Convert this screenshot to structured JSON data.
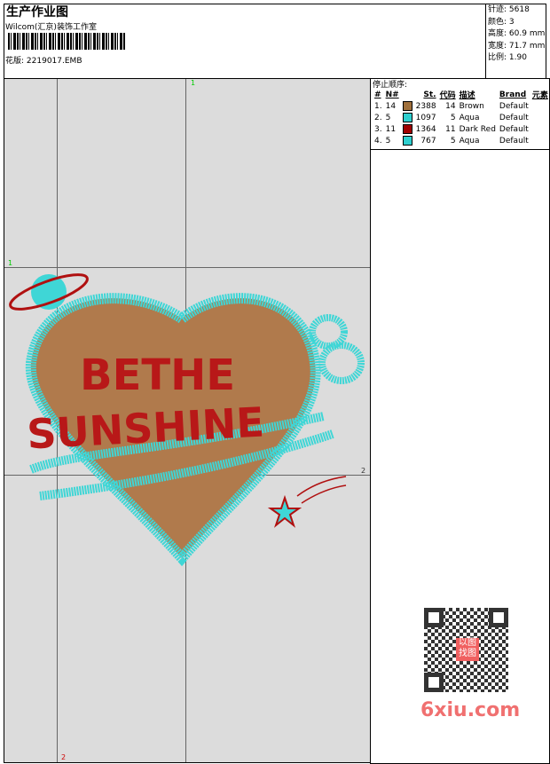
{
  "header": {
    "title": "生产作业图",
    "company": "Wilcom(汇京)装饰工作室",
    "design_label": "花版:",
    "design_file": "2219017.EMB"
  },
  "stats": [
    {
      "label": "针迹:",
      "value": "5618"
    },
    {
      "label": "颜色:",
      "value": "3"
    },
    {
      "label": "高度:",
      "value": "60.9 mm"
    },
    {
      "label": "宽度:",
      "value": "71.7 mm"
    },
    {
      "label": "比例:",
      "value": "1.90"
    }
  ],
  "stop_sequence": {
    "title": "停止顺序:",
    "columns": [
      "#",
      "N#",
      "St.",
      "代码",
      "描述",
      "Brand",
      "元素"
    ],
    "rows": [
      {
        "idx": "1.",
        "n": "14",
        "color": "#a0703c",
        "st": "2388",
        "code": "14",
        "desc": "Brown",
        "brand": "Default"
      },
      {
        "idx": "2.",
        "n": "5",
        "color": "#2ecfcf",
        "st": "1097",
        "code": "5",
        "desc": "Aqua",
        "brand": "Default"
      },
      {
        "idx": "3.",
        "n": "11",
        "color": "#a00000",
        "st": "1364",
        "code": "11",
        "desc": "Dark Red",
        "brand": "Default"
      },
      {
        "idx": "4.",
        "n": "5",
        "color": "#2ecfcf",
        "st": "767",
        "code": "5",
        "desc": "Aqua",
        "brand": "Default"
      }
    ]
  },
  "canvas": {
    "markers": {
      "green": "1",
      "red": "2"
    },
    "design_text": [
      "BETHE",
      "SUNSHINE"
    ]
  },
  "watermark": {
    "text": "6xiu.com",
    "seal": "以图找图"
  }
}
